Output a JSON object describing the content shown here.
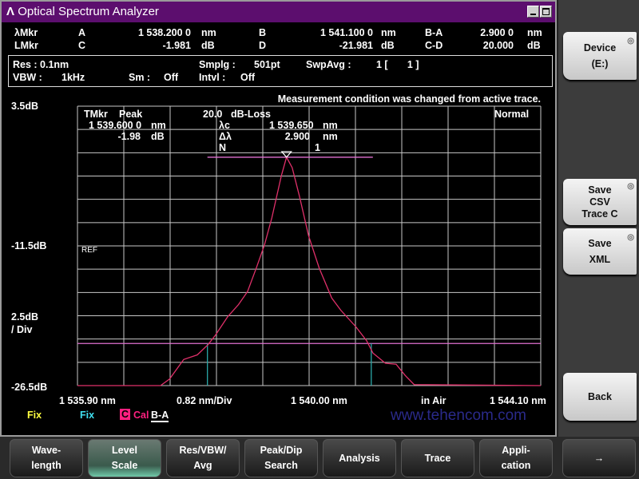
{
  "window": {
    "title": "Optical Spectrum Analyzer",
    "logo_glyph": "Λ"
  },
  "markers": {
    "row1": {
      "label": "λMkr",
      "a_label": "A",
      "a_value": "1 538.200 0",
      "a_unit": "nm",
      "b_label": "B",
      "b_value": "1 541.100 0",
      "b_unit": "nm",
      "ba_label": "B-A",
      "ba_value": "2.900 0",
      "ba_unit": "nm"
    },
    "row2": {
      "label": "LMkr",
      "c_label": "C",
      "c_value": "-1.981",
      "c_unit": "dB",
      "d_label": "D",
      "d_value": "-21.981",
      "d_unit": "dB",
      "cd_label": "C-D",
      "cd_value": "20.000",
      "cd_unit": "dB"
    }
  },
  "conditions": {
    "res": "Res :  0.1nm",
    "smplg_label": "Smplg :",
    "smplg_value": "501pt",
    "swpavg_label": "SwpAvg :",
    "swpavg_value": "1 [       1 ]",
    "vbw_label": "VBW :",
    "vbw_value": "1kHz",
    "sm_label": "Sm :",
    "sm_value": "Off",
    "intvl_label": "Intvl :",
    "intvl_value": "Off"
  },
  "message": "Measurement condition was changed from active trace.",
  "analysis_table": {
    "tmkr": "TMkr",
    "peak": "Peak",
    "peak_wl": "1 539.600 0",
    "peak_wl_unit": "nm",
    "peak_level": "-1.98",
    "peak_level_unit": "dB",
    "threshold": "20.0",
    "method": "dB-Loss",
    "lc_label": "λc",
    "lc_value": "1 539.650",
    "lc_unit": "nm",
    "dl_label": "Δλ",
    "dl_value": "2.900",
    "dl_unit": "nm",
    "n_label": "N",
    "n_value": "1",
    "mode": "Normal"
  },
  "axis": {
    "y_top": "3.5dB",
    "y_ref": "-11.5dB",
    "y_div": "2.5dB",
    "y_div2": "/ Div",
    "y_bottom": "-26.5dB",
    "ref_label": "REF",
    "x_start": "1 535.90 nm",
    "x_div": "0.82 nm/Div",
    "x_center": "1 540.00 nm",
    "medium": "in Air",
    "x_stop": "1 544.10 nm"
  },
  "trace_status": {
    "trace_a": "Fix",
    "trace_b": "Fix",
    "trace_c_letter": "C",
    "trace_c_mode": "Cal",
    "trace_c_calc": "B-A"
  },
  "watermark": "www.tehencom.com",
  "side_keys": [
    {
      "line1": "Device",
      "line2": "(E:)",
      "line3": ""
    },
    {
      "line1": "Save",
      "line2": "CSV",
      "line3": "Trace C"
    },
    {
      "line1": "Save",
      "line2": "XML",
      "line3": ""
    },
    {
      "line1": "Back",
      "line2": "",
      "line3": ""
    }
  ],
  "function_keys": [
    {
      "line1": "Wave-",
      "line2": "length"
    },
    {
      "line1": "Level",
      "line2": "Scale",
      "active": true
    },
    {
      "line1": "Res/VBW/",
      "line2": "Avg"
    },
    {
      "line1": "Peak/Dip",
      "line2": "Search"
    },
    {
      "line1": "Analysis",
      "line2": ""
    },
    {
      "line1": "Trace",
      "line2": ""
    },
    {
      "line1": "Appli-",
      "line2": "cation"
    },
    {
      "line1": "→",
      "line2": ""
    }
  ],
  "colors": {
    "title_bar": "#5c0e6e",
    "trace": "#e0306a",
    "threshold": "#e070d0",
    "marker_lines": "#2aa8a8",
    "grid": "#c8c8c8",
    "fix_a": "#ffff40",
    "fix_b": "#40e0f0",
    "trace_c": "#ff2080",
    "watermark": "#2a2a8a"
  },
  "chart_data": {
    "type": "line",
    "xlim": [
      1535.9,
      1544.1
    ],
    "ylim": [
      -26.5,
      3.5
    ],
    "x_unit": "nm",
    "y_unit": "dB",
    "x_divisions": 10,
    "y_divisions": 12,
    "grid": true,
    "series": [
      {
        "x": [
          1535.9,
          1537.37,
          1537.53,
          1537.78,
          1538.02,
          1538.21,
          1538.34,
          1538.56,
          1538.75,
          1538.91,
          1539.07,
          1539.21,
          1539.34,
          1539.51,
          1539.6,
          1539.7,
          1539.83,
          1539.99,
          1540.18,
          1540.4,
          1540.56,
          1540.83,
          1541.02,
          1541.13,
          1541.35,
          1541.54,
          1541.7,
          1541.86,
          1544.1
        ],
        "y": [
          -26.5,
          -26.5,
          -25.8,
          -23.7,
          -23.2,
          -22.1,
          -21.1,
          -19.1,
          -17.8,
          -16.4,
          -13.8,
          -11.4,
          -8.5,
          -3.95,
          -1.98,
          -3.1,
          -6.2,
          -10.4,
          -13.9,
          -17.1,
          -18.4,
          -20.2,
          -21.7,
          -23.0,
          -24.1,
          -24.2,
          -25.4,
          -26.4,
          -26.5
        ]
      }
    ],
    "marker_a_nm": 1538.2,
    "marker_b_nm": 1541.1,
    "peak_level_db": -1.98,
    "threshold_level_db": -21.98
  }
}
